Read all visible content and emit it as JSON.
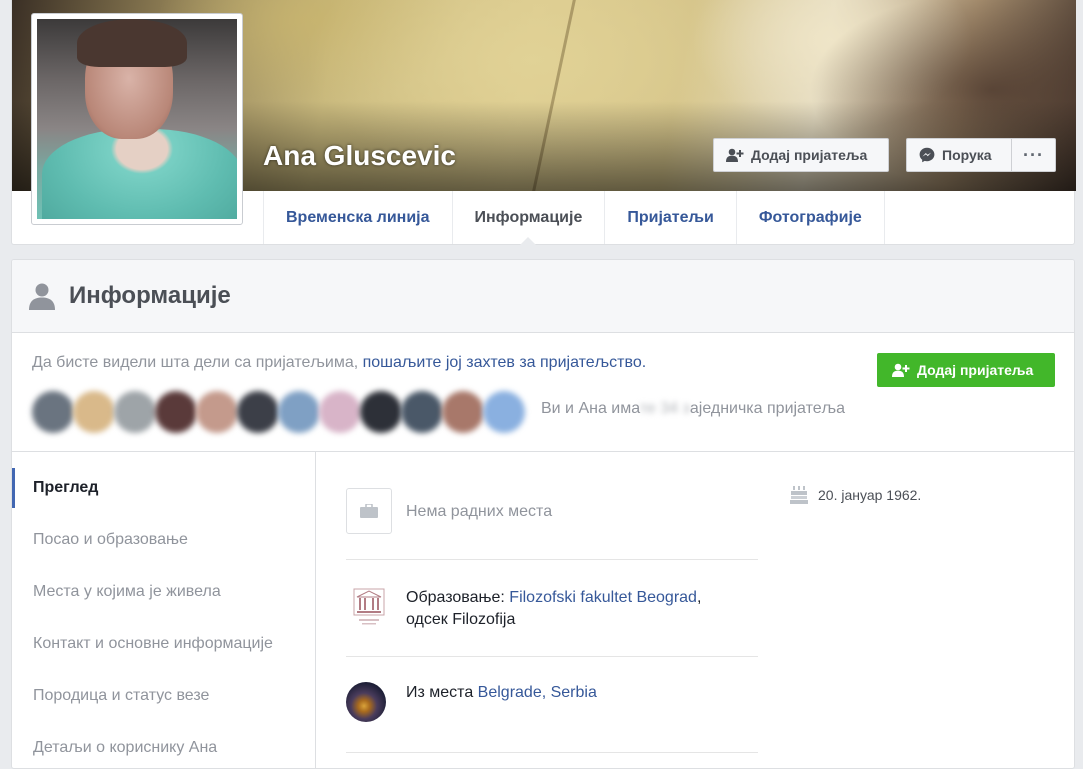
{
  "profile": {
    "name": "Ana Gluscevic",
    "add_friend_label": "Додај пријатеља",
    "message_label": "Порука",
    "more_label": "···"
  },
  "tabs": [
    {
      "label": "Временска линија",
      "active": false
    },
    {
      "label": "Информације",
      "active": true
    },
    {
      "label": "Пријатељи",
      "active": false
    },
    {
      "label": "Фотографије",
      "active": false
    }
  ],
  "about": {
    "title": "Информације",
    "prompt_text": "Да бисте видели шта дели са пријатељима, ",
    "prompt_link": "пошаљите јој захтев за пријатељство.",
    "add_friend_label": "Додај пријатеља",
    "mutual_prefix": "Ви и Ана има",
    "mutual_blurred": "те 34 з",
    "mutual_suffix": "аједничка пријатеља"
  },
  "sidenav": {
    "items": [
      {
        "label": "Преглед",
        "active": true
      },
      {
        "label": "Посао и образовање",
        "active": false
      },
      {
        "label": "Места у којима је живела",
        "active": false
      },
      {
        "label": "Контакт и основне информације",
        "active": false
      },
      {
        "label": "Породица и статус везе",
        "active": false
      },
      {
        "label": "Детаљи о кориснику Ана",
        "active": false
      }
    ]
  },
  "overview": {
    "work_text": "Нема радних места",
    "education_prefix": "Образовање: ",
    "education_link": "Filozofski fakultet Beograd",
    "education_comma": ",",
    "education_dept": "одсек Filozofija",
    "from_prefix": "Из места ",
    "from_link": "Belgrade, Serbia",
    "birthday": "20. јануар 1962."
  },
  "colors": {
    "link_blue": "#365899",
    "accent_blue": "#4267b2",
    "green": "#42b72a",
    "muted_gray": "#90949c"
  },
  "icons": {
    "add_friend": "person-plus-icon",
    "message": "messenger-icon",
    "about": "person-icon",
    "work": "briefcase-icon",
    "education": "college-logo-icon",
    "birthday": "cake-icon"
  }
}
